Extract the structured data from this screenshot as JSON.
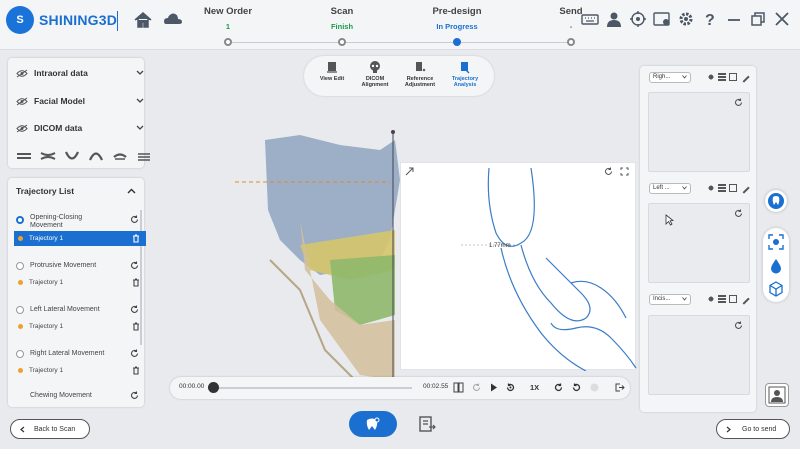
{
  "header": {
    "logo_text": "SHINING3D",
    "logo_mark": "S",
    "steps": [
      {
        "title": "New Order",
        "status": "1",
        "status_color": "#1a9c4a"
      },
      {
        "title": "Scan",
        "status": "Finish",
        "status_color": "#1a9c4a"
      },
      {
        "title": "Pre-design",
        "status": "In Progress",
        "status_color": "#1a6fd0"
      },
      {
        "title": "Send",
        "status": "-",
        "status_color": "#666666"
      }
    ]
  },
  "left_panel": {
    "data_items": [
      {
        "label": "Intraoral data"
      },
      {
        "label": "Facial Model"
      },
      {
        "label": "DICOM data"
      }
    ],
    "trajectory": {
      "title": "Trajectory List",
      "movements": [
        {
          "label": "Opening-Closing Movement",
          "sub": "Trajectory 1"
        },
        {
          "label": "Protrusive Movement",
          "sub": "Trajectory 1"
        },
        {
          "label": "Left Lateral Movement",
          "sub": "Trajectory 1"
        },
        {
          "label": "Right Lateral Movement",
          "sub": "Trajectory 1"
        },
        {
          "label": "Chewing Movement"
        }
      ]
    }
  },
  "analysis_toolbar": {
    "items": [
      {
        "label": "View Edit"
      },
      {
        "label": "DICOM Alignment"
      },
      {
        "label": "Reference Adjustment"
      },
      {
        "label": "Trajectory Analysis"
      }
    ]
  },
  "viewer": {
    "measurement": "1.77mm"
  },
  "right_panel": {
    "selects": [
      "Righ...",
      "Left ...",
      "Incis..."
    ]
  },
  "playback": {
    "start_time": "00:00.00",
    "end_time": "00:02.55",
    "speed": "1X",
    "progress": 0
  },
  "footer": {
    "back_label": "Back to Scan",
    "next_label": "Go to send"
  },
  "colors": {
    "accent": "#1a6fd0",
    "finish": "#1a9c4a",
    "trajectory_dot": "#f0a030"
  }
}
